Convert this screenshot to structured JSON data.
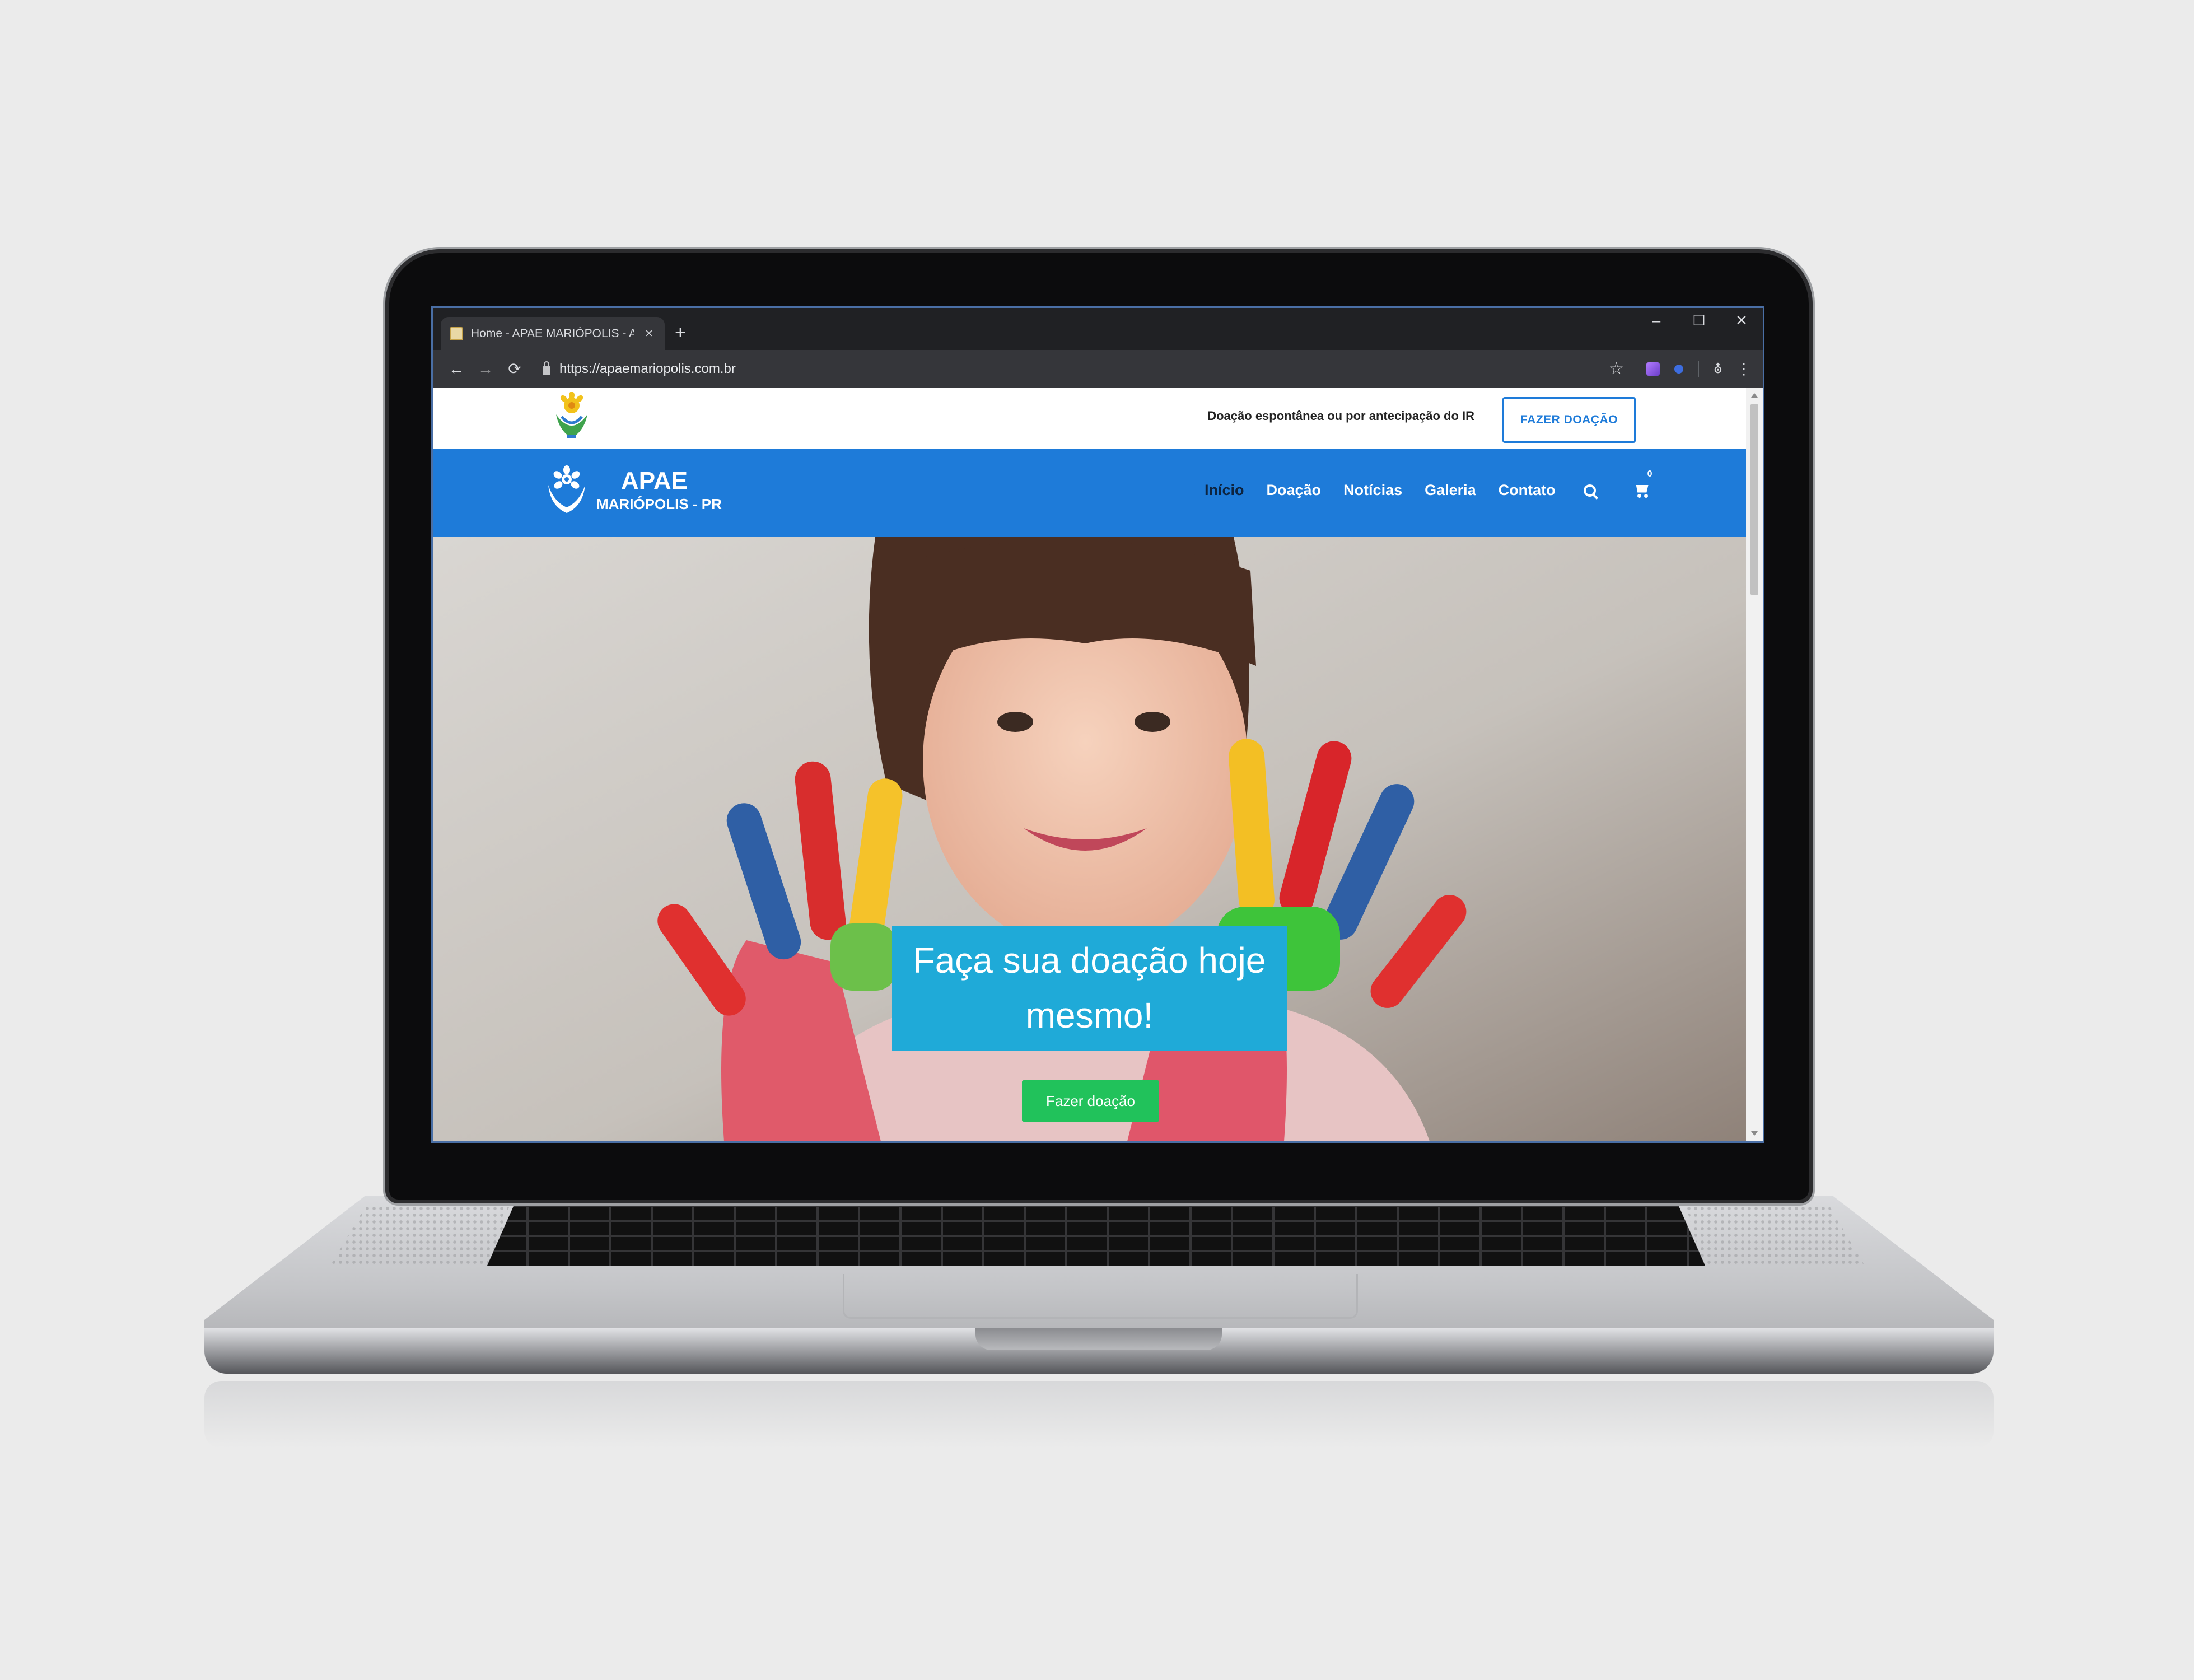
{
  "browser": {
    "tab_title": "Home - APAE MARIÓPOLIS - A A",
    "tab_close": "×",
    "new_tab": "+",
    "url": "https://apaemariopolis.com.br",
    "window_controls": {
      "minimize": "–",
      "maximize": "☐",
      "close": "✕"
    },
    "nav": {
      "back": "←",
      "forward": "→",
      "reload": "⟳"
    },
    "bookmark_star": "☆",
    "menu_dots": "⋮",
    "incognito": "⛢"
  },
  "site": {
    "topbar": {
      "tagline": "Doação espontânea ou por antecipação do IR",
      "donate_button": "FAZER DOAÇÃO"
    },
    "brand": {
      "name": "APAE",
      "subtitle": "MARIÓPOLIS - PR"
    },
    "menu": [
      "Início",
      "Doação",
      "Notícias",
      "Galeria",
      "Contato"
    ],
    "active_menu_index": 0,
    "cart_count": "0",
    "hero": {
      "headline": "Faça sua doação hoje mesmo!",
      "cta": "Fazer doação"
    }
  },
  "colors": {
    "nav_blue": "#1e7bd9",
    "headline_bg": "#1faad8",
    "cta_green": "#21c25b",
    "active_menu": "#0d2440"
  }
}
